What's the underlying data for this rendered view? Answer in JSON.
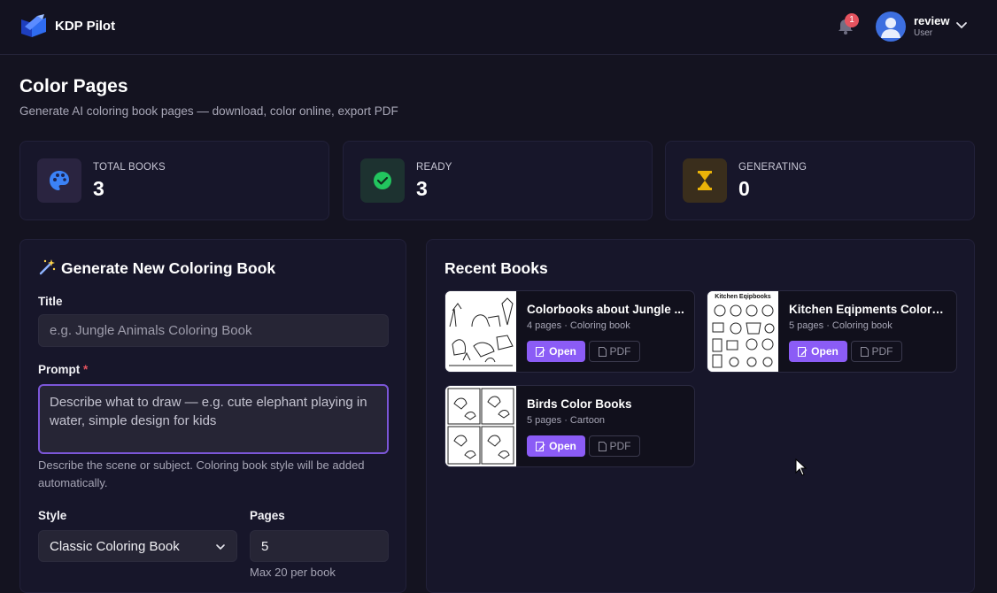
{
  "app": {
    "name": "KDP Pilot"
  },
  "header": {
    "notifications_count": "1",
    "user": {
      "name": "review",
      "role": "User"
    }
  },
  "page": {
    "title": "Color Pages",
    "subtitle": "Generate AI coloring book pages — download, color online, export PDF"
  },
  "stats": [
    {
      "label": "TOTAL BOOKS",
      "value": "3",
      "icon": "palette-icon",
      "color": "#3b82f6"
    },
    {
      "label": "READY",
      "value": "3",
      "icon": "check-circle-icon",
      "color": "#22c55e"
    },
    {
      "label": "GENERATING",
      "value": "0",
      "icon": "hourglass-icon",
      "color": "#eab308"
    }
  ],
  "generate": {
    "title": "Generate New Coloring Book",
    "title_label": "Title",
    "title_placeholder": "e.g. Jungle Animals Coloring Book",
    "prompt_label": "Prompt",
    "prompt_required": "*",
    "prompt_placeholder": "Describe what to draw — e.g. cute elephant playing in water, simple design for kids",
    "prompt_hint": "Describe the scene or subject. Coloring book style will be added automatically.",
    "style_label": "Style",
    "style_value": "Classic Coloring Book",
    "pages_label": "Pages",
    "pages_value": "5",
    "pages_hint": "Max 20 per book"
  },
  "recent": {
    "title": "Recent Books",
    "open_label": "Open",
    "pdf_label": "PDF",
    "books": [
      {
        "title": "Colorbooks about Jungle ...",
        "meta": "4 pages · Coloring book"
      },
      {
        "title": "Kitchen Eqipments Colorb...",
        "meta": "5 pages · Coloring book",
        "thumb_caption": "Kitchen Eqipbooks"
      },
      {
        "title": "Birds Color Books",
        "meta": "5 pages · Cartoon"
      }
    ]
  },
  "colors": {
    "accent": "#8b5cf6",
    "background": "#141320",
    "panel": "#17162a"
  }
}
